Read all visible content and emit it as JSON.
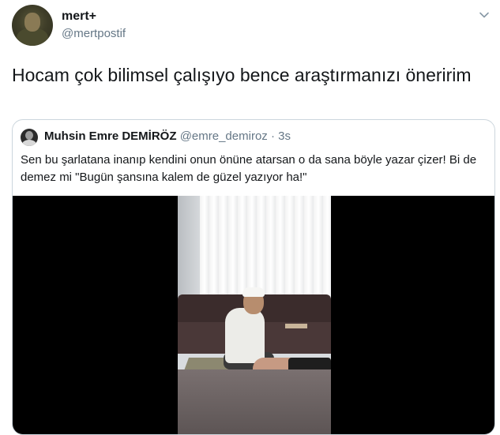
{
  "author": {
    "display_name": "mert+",
    "handle": "@mertpostif"
  },
  "tweet": {
    "text": "Hocam çok bilimsel çalışıyo bence araştırmanızı öneririm"
  },
  "quoted_tweet": {
    "author_name": "Muhsin Emre DEMİRÖZ",
    "author_handle": "@emre_demiroz",
    "separator": "·",
    "time": "3s",
    "text": "Sen bu şarlatana inanıp kendini onun önüne atarsan o da sana böyle yazar çizer! Bi de demez mi \"Bugün şansına kalem de güzel yazıyor ha!\""
  },
  "icons": {
    "menu": "chevron-down-icon"
  },
  "colors": {
    "text_primary": "#14171a",
    "text_secondary": "#657786",
    "border": "#ccd6dd",
    "video_bg": "#000000"
  }
}
